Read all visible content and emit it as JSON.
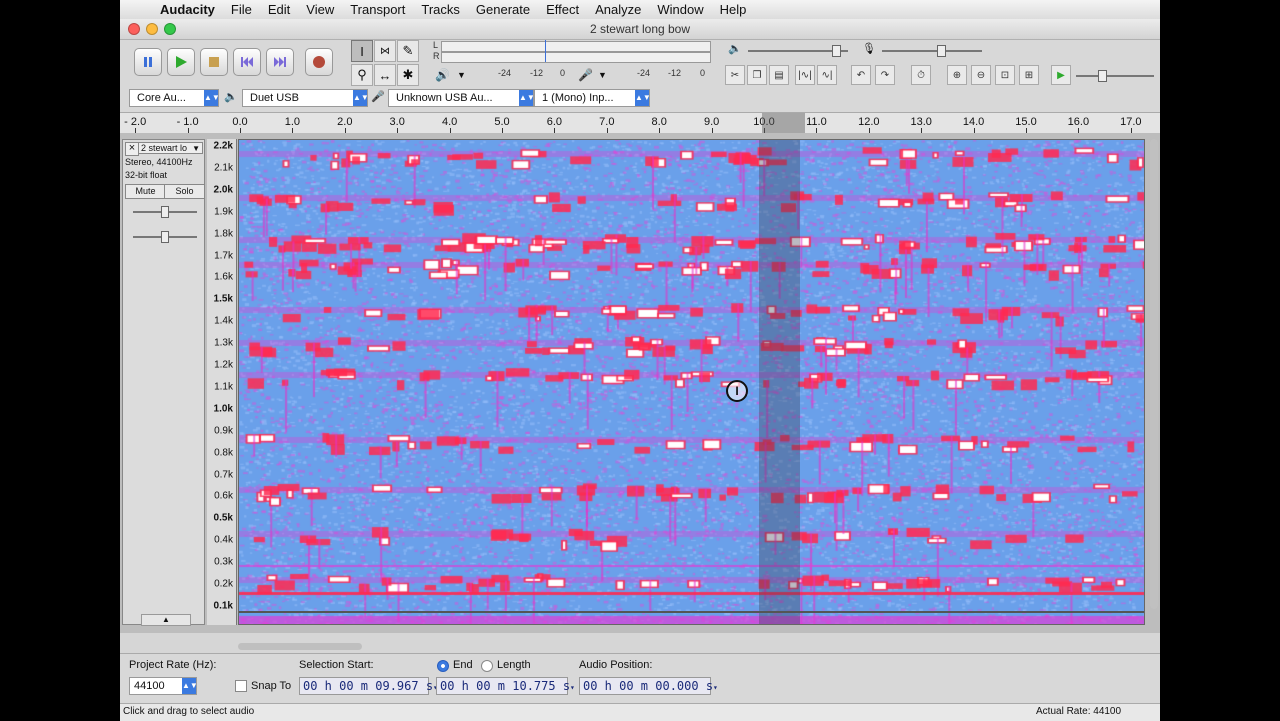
{
  "menubar": {
    "app": "Audacity",
    "items": [
      "File",
      "Edit",
      "View",
      "Transport",
      "Tracks",
      "Generate",
      "Effect",
      "Analyze",
      "Window",
      "Help"
    ]
  },
  "window": {
    "title": "2 stewart long bow"
  },
  "toolbar": {
    "transport": [
      "pause-icon",
      "play-icon",
      "stop-icon",
      "skip-start-icon",
      "skip-end-icon",
      "record-icon"
    ],
    "tools": [
      "selection-icon",
      "envelope-icon",
      "draw-icon",
      "zoom-icon",
      "timeshift-icon",
      "multi-icon"
    ],
    "meter_ticks": [
      "-24",
      "-12",
      "0"
    ],
    "meter_lr": [
      "L",
      "R"
    ],
    "edit_icons": [
      "cut-icon",
      "copy-icon",
      "paste-icon",
      "trim-icon",
      "silence-icon",
      "undo-icon",
      "redo-icon",
      "sync-lock-icon",
      "zoom-in-icon",
      "zoom-out-icon",
      "fit-selection-icon",
      "fit-project-icon",
      "play-at-speed-icon"
    ]
  },
  "devices": {
    "host": "Core Au...",
    "output": "Duet USB",
    "input": "Unknown USB Au...",
    "channels": "1 (Mono) Inp..."
  },
  "ruler": {
    "labels": [
      "- 2.0",
      "- 1.0",
      "0.0",
      "1.0",
      "2.0",
      "3.0",
      "4.0",
      "5.0",
      "6.0",
      "7.0",
      "8.0",
      "9.0",
      "10.0",
      "11.0",
      "12.0",
      "13.0",
      "14.0",
      "15.0",
      "16.0",
      "17.0"
    ],
    "values": [
      -2,
      -1,
      0,
      1,
      2,
      3,
      4,
      5,
      6,
      7,
      8,
      9,
      10,
      11,
      12,
      13,
      14,
      15,
      16,
      17
    ]
  },
  "track": {
    "name": "2 stewart lo",
    "format": "Stereo, 44100Hz",
    "bits": "32-bit float",
    "mute": "Mute",
    "solo": "Solo",
    "close": "×"
  },
  "freq_axis": {
    "labels": [
      {
        "t": "2.2k",
        "b": true,
        "v": 2.2
      },
      {
        "t": "2.1k",
        "b": false,
        "v": 2.1
      },
      {
        "t": "2.0k",
        "b": true,
        "v": 2.0
      },
      {
        "t": "1.9k",
        "b": false,
        "v": 1.9
      },
      {
        "t": "1.8k",
        "b": false,
        "v": 1.8
      },
      {
        "t": "1.7k",
        "b": false,
        "v": 1.7
      },
      {
        "t": "1.6k",
        "b": false,
        "v": 1.6
      },
      {
        "t": "1.5k",
        "b": true,
        "v": 1.5
      },
      {
        "t": "1.4k",
        "b": false,
        "v": 1.4
      },
      {
        "t": "1.3k",
        "b": false,
        "v": 1.3
      },
      {
        "t": "1.2k",
        "b": false,
        "v": 1.2
      },
      {
        "t": "1.1k",
        "b": false,
        "v": 1.1
      },
      {
        "t": "1.0k",
        "b": true,
        "v": 1.0
      },
      {
        "t": "0.9k",
        "b": false,
        "v": 0.9
      },
      {
        "t": "0.8k",
        "b": false,
        "v": 0.8
      },
      {
        "t": "0.7k",
        "b": false,
        "v": 0.7
      },
      {
        "t": "0.6k",
        "b": false,
        "v": 0.6
      },
      {
        "t": "0.5k",
        "b": true,
        "v": 0.5
      },
      {
        "t": "0.4k",
        "b": false,
        "v": 0.4
      },
      {
        "t": "0.3k",
        "b": false,
        "v": 0.3
      },
      {
        "t": "0.2k",
        "b": false,
        "v": 0.2
      },
      {
        "t": "0.1k",
        "b": true,
        "v": 0.1
      }
    ]
  },
  "selection": {
    "project_rate_label": "Project Rate (Hz):",
    "project_rate": "44100",
    "snap_to": "Snap To",
    "start_label": "Selection Start:",
    "end_label": "End",
    "length_label": "Length",
    "audio_position_label": "Audio Position:",
    "start_value": "00 h 00 m 09.967 s",
    "end_value": "00 h 00 m 10.775 s",
    "position_value": "00 h 00 m 00.000 s",
    "selection_start_s": 9.967,
    "selection_end_s": 10.775
  },
  "status": {
    "left": "Click and drag to select audio",
    "right": "Actual Rate: 44100"
  },
  "colors": {
    "spec_bg": "#6aa0ea",
    "spec_mid": "#e23cd8",
    "spec_hot": "#ff2a50",
    "spec_peak": "#ffffff"
  }
}
